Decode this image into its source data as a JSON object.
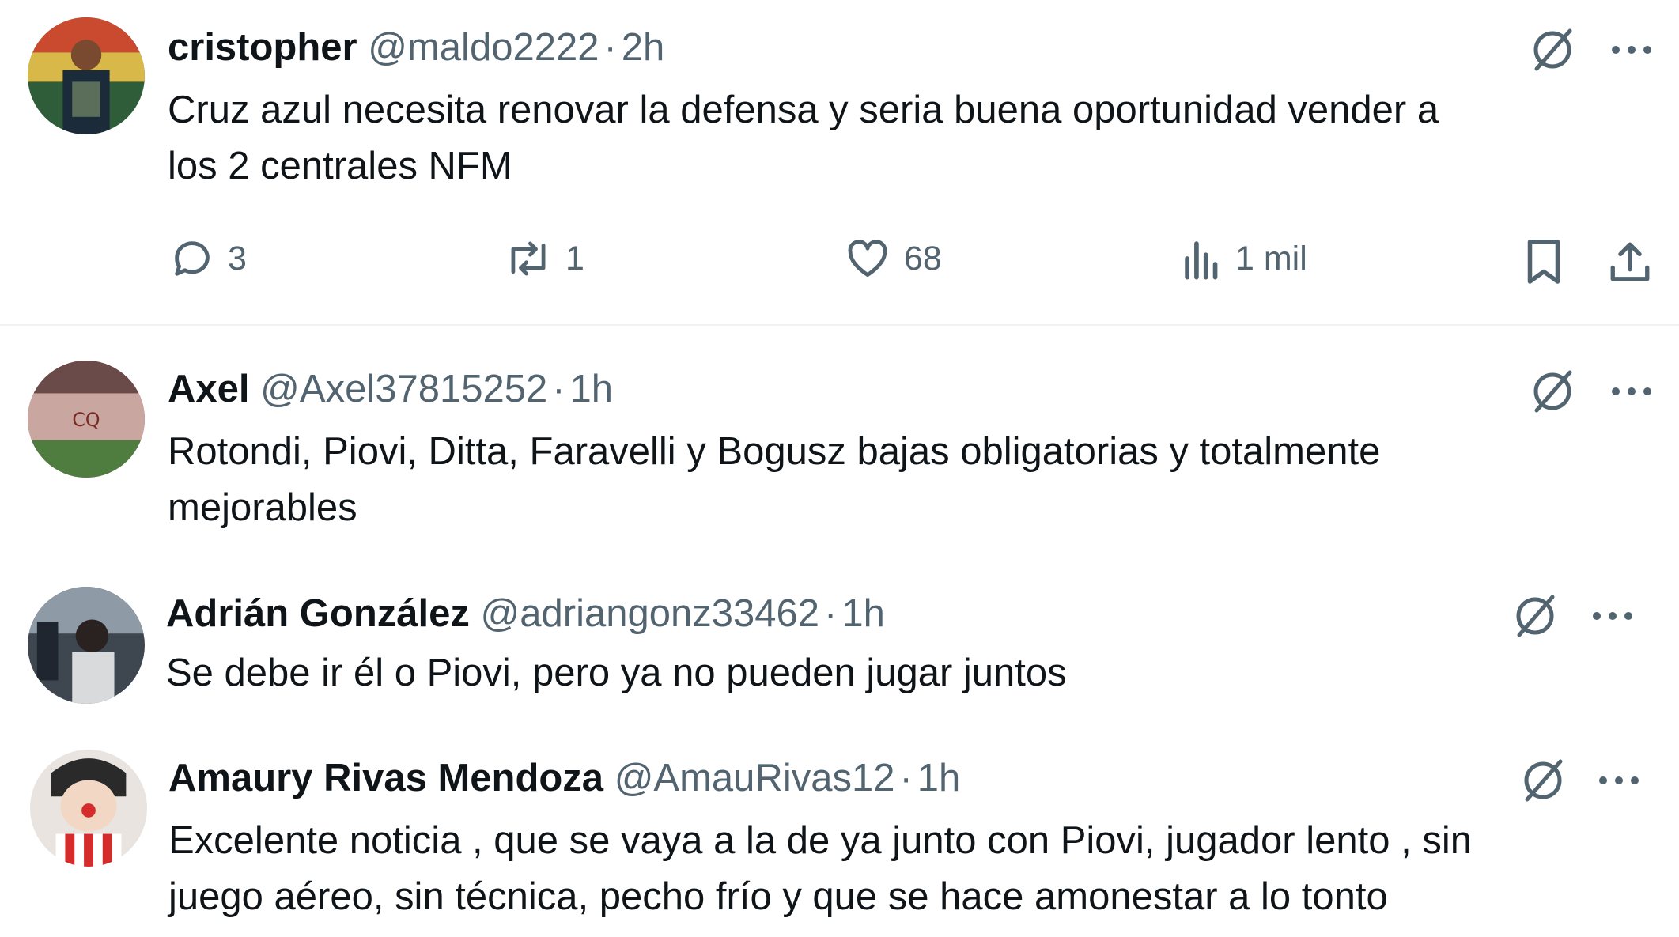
{
  "posts": [
    {
      "name": "cristopher",
      "handle": "@maldo2222",
      "separator": "·",
      "time": "2h",
      "line1": "Cruz azul necesita renovar la defensa y seria buena oportunidad vender a",
      "line2": "los 2 centrales NFM",
      "actions": {
        "replies": "3",
        "reposts": "1",
        "likes": "68",
        "views": "1 mil"
      }
    },
    {
      "name": "Axel",
      "handle": "@Axel37815252",
      "separator": "·",
      "time": "1h",
      "line1": "Rotondi, Piovi, Ditta, Faravelli y Bogusz bajas obligatorias y totalmente",
      "line2": "mejorables"
    },
    {
      "name": "Adrián González",
      "handle": "@adriangonz33462",
      "separator": "·",
      "time": "1h",
      "line1": "Se debe ir él o Piovi, pero ya no pueden jugar juntos"
    },
    {
      "name": "Amaury Rivas Mendoza",
      "handle": "@AmauRivas12",
      "separator": "·",
      "time": "1h",
      "line1": "Excelente noticia , que se vaya a la de ya junto con Piovi, jugador lento , sin",
      "line2": "juego aéreo, sin técnica, pecho frío y que se hace amonestar a lo tonto"
    }
  ],
  "icons": {
    "grok": "grok-icon",
    "more": "more-icon",
    "reply": "reply-icon",
    "repost": "repost-icon",
    "like": "like-icon",
    "views": "views-icon",
    "bookmark": "bookmark-icon",
    "share": "share-icon"
  },
  "colors": {
    "text": "#0f1419",
    "secondary": "#536471",
    "divider": "#eff3f4"
  }
}
